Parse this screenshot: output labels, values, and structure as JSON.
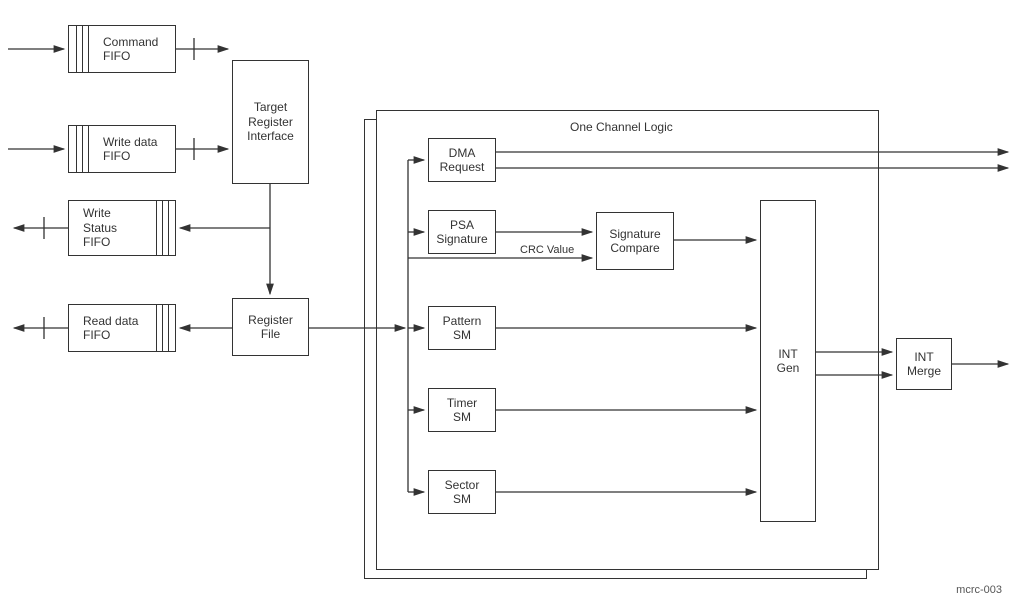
{
  "fifos": {
    "command": "Command\nFIFO",
    "write_data": "Write data\nFIFO",
    "write_status": "Write\nStatus\nFIFO",
    "read_data": "Read data\nFIFO"
  },
  "blocks": {
    "target_reg_if": "Target\nRegister\nInterface",
    "register_file": "Register\nFile",
    "dma_request": "DMA\nRequest",
    "psa_signature": "PSA\nSignature",
    "signature_compare": "Signature\nCompare",
    "pattern_sm": "Pattern\nSM",
    "timer_sm": "Timer\nSM",
    "sector_sm": "Sector\nSM",
    "int_gen": "INT\nGen",
    "int_merge": "INT\nMerge"
  },
  "labels": {
    "one_channel": "One Channel Logic",
    "crc_value": "CRC Value",
    "figure_id": "mcrc-003"
  }
}
